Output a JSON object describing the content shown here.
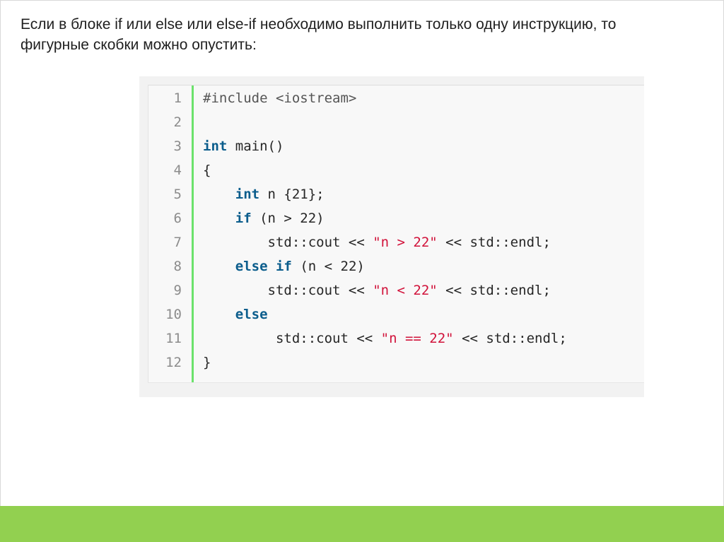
{
  "slide": {
    "text_line1": "Если в блоке if или else или else-if необходимо выполнить только одну инструкцию, то",
    "text_line2": "фигурные скобки можно опустить:"
  },
  "code": {
    "line_numbers": [
      "1",
      "2",
      "3",
      "4",
      "5",
      "6",
      "7",
      "8",
      "9",
      "10",
      "11",
      "12"
    ],
    "lines": [
      [
        {
          "t": "#include <iostream>",
          "c": "pp"
        }
      ],
      [],
      [
        {
          "t": "int",
          "c": "kw"
        },
        {
          "t": " main()"
        }
      ],
      [
        {
          "t": "{"
        }
      ],
      [
        {
          "t": "    "
        },
        {
          "t": "int",
          "c": "kw"
        },
        {
          "t": " n {21};"
        }
      ],
      [
        {
          "t": "    "
        },
        {
          "t": "if",
          "c": "kw"
        },
        {
          "t": " (n > 22)"
        }
      ],
      [
        {
          "t": "        std::cout << "
        },
        {
          "t": "\"n > 22\"",
          "c": "str"
        },
        {
          "t": " << std::endl;"
        }
      ],
      [
        {
          "t": "    "
        },
        {
          "t": "else",
          "c": "kw"
        },
        {
          "t": " "
        },
        {
          "t": "if",
          "c": "kw"
        },
        {
          "t": " (n < 22)"
        }
      ],
      [
        {
          "t": "        std::cout << "
        },
        {
          "t": "\"n < 22\"",
          "c": "str"
        },
        {
          "t": " << std::endl;"
        }
      ],
      [
        {
          "t": "    "
        },
        {
          "t": "else",
          "c": "kw"
        }
      ],
      [
        {
          "t": "         std::cout << "
        },
        {
          "t": "\"n == 22\"",
          "c": "str"
        },
        {
          "t": " << std::endl;"
        }
      ],
      [
        {
          "t": "}"
        }
      ]
    ]
  },
  "colors": {
    "gutter_border": "#6ce26c",
    "keyword": "#0b5d8c",
    "string": "#d1123a",
    "footer": "#92d050"
  }
}
